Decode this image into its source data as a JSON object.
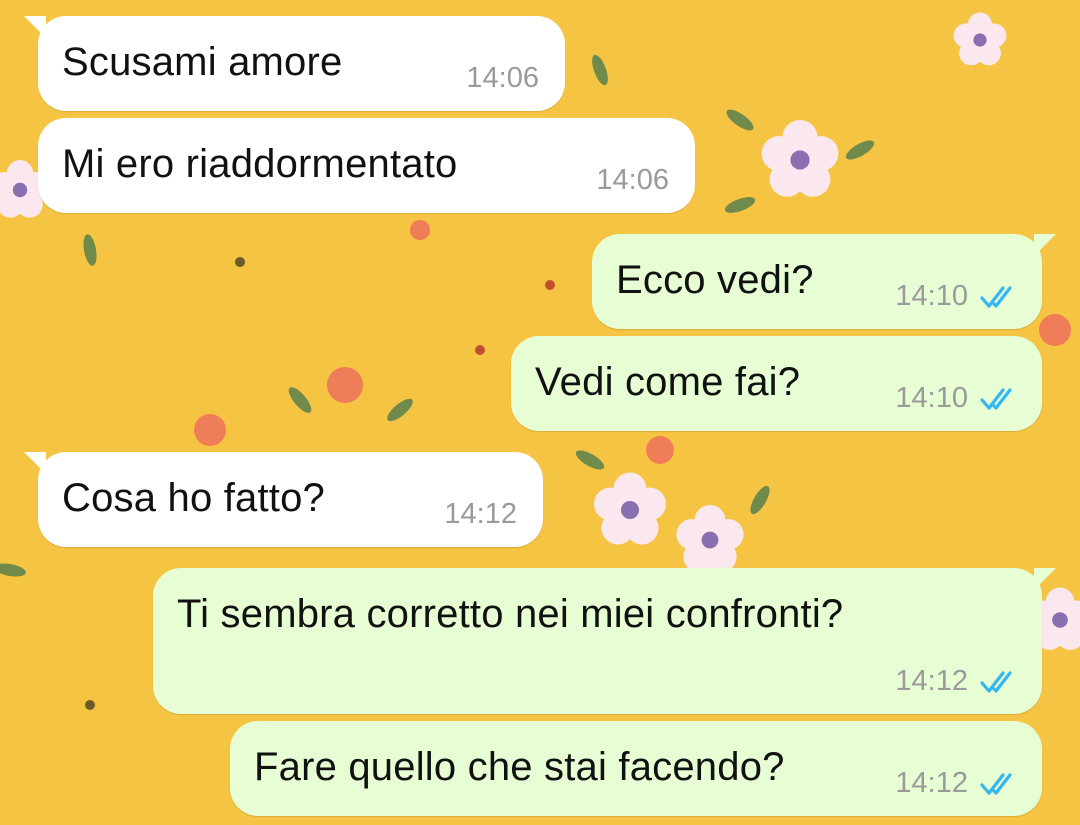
{
  "messages": [
    {
      "direction": "incoming",
      "text": "Scusami amore",
      "time": "14:06"
    },
    {
      "direction": "incoming",
      "text": "Mi ero riaddormentato",
      "time": "14:06"
    },
    {
      "direction": "outgoing",
      "text": "Ecco vedi?",
      "time": "14:10",
      "status": "read"
    },
    {
      "direction": "outgoing",
      "text": "Vedi come fai?",
      "time": "14:10",
      "status": "read"
    },
    {
      "direction": "incoming",
      "text": "Cosa ho fatto?",
      "time": "14:12"
    },
    {
      "direction": "outgoing",
      "text": "Ti sembra corretto nei miei confronti?",
      "time": "14:12",
      "status": "read"
    },
    {
      "direction": "outgoing",
      "text": "Fare quello che stai facendo?",
      "time": "14:12",
      "status": "read"
    }
  ],
  "colors": {
    "wallpaper": "#f6c443",
    "incoming_bubble": "#ffffff",
    "outgoing_bubble": "#e7fdd3",
    "read_tick": "#34b7f1",
    "timestamp": "#9a9a9a"
  },
  "icons": {
    "read_receipt": "double-check-icon",
    "wallpaper": "floral-wallpaper"
  }
}
